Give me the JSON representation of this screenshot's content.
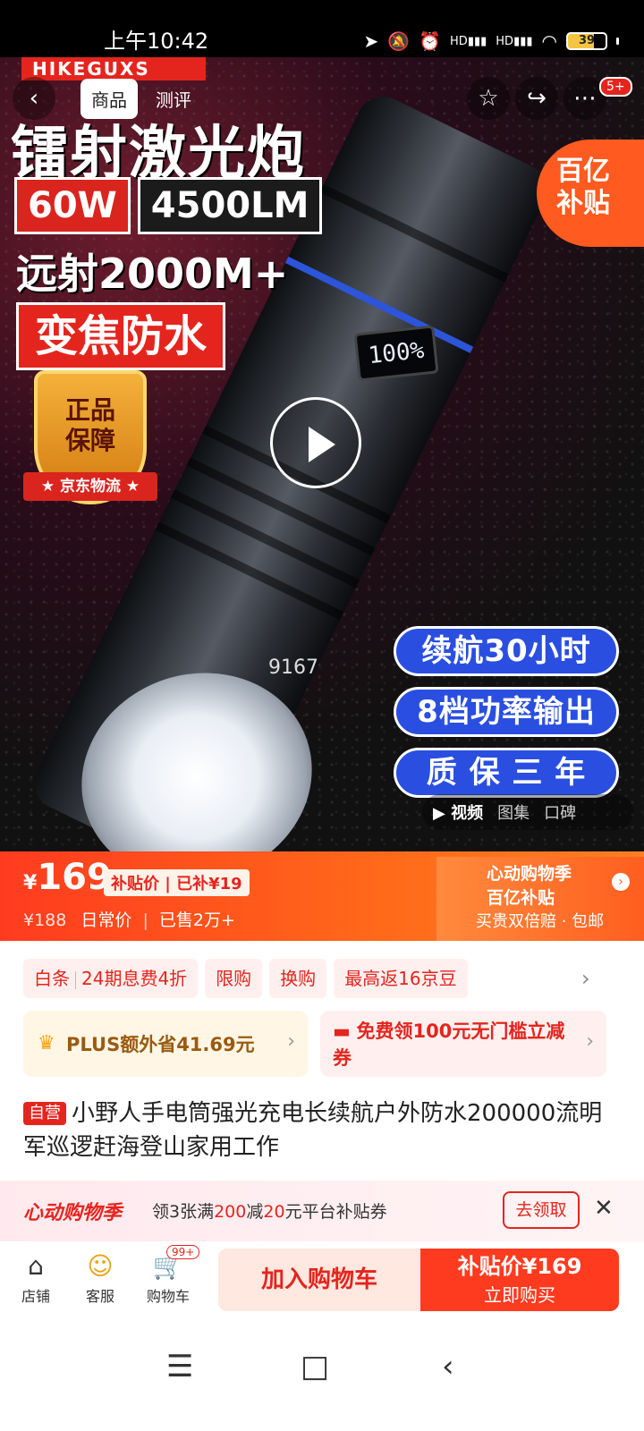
{
  "status_bar": {
    "time": "上午10:42",
    "signal1": "HD",
    "signal2": "HD",
    "battery": "39"
  },
  "header": {
    "back": "‹",
    "tabs": [
      "商品",
      "测评"
    ],
    "active_tab": "商品",
    "icons": [
      "star-icon",
      "share-icon",
      "more-icon"
    ],
    "notification_count": "5+"
  },
  "hero": {
    "brand": "HIKEGUXS",
    "headline": "镭射激光炮",
    "spec1": "60W",
    "spec2": "4500LM",
    "range": "远射2000M+",
    "feature": "变焦防水",
    "guarantee_text": "正品\n保障",
    "guarantee_ribbon": "★ 京东物流 ★",
    "display_value": "100",
    "pills": [
      "续航30小时",
      "8档功率输出",
      "质 保 三 年"
    ],
    "subsidy_badge": "百亿\n补贴",
    "image_counter": "9167",
    "media_tabs": [
      "▶ 视频",
      "图集",
      "口碑"
    ]
  },
  "price": {
    "currency": "¥",
    "value": "169",
    "subsidy_tag": "补贴价 | 已补¥19",
    "original": "¥188",
    "original_label": "日常价",
    "sold": "已售2万+",
    "promo_title": "心动购物季",
    "promo_title2": "百亿补贴",
    "promo_sub": "买贵双倍赔 · 包邮"
  },
  "chips": {
    "items": [
      "白条",
      "24期息费4折",
      "限购",
      "换购",
      "最高返16京豆"
    ]
  },
  "cards": {
    "plus": "PLUS额外省41.69元",
    "coupon_strong": "免费领100元无门槛立减券"
  },
  "product": {
    "self_tag": "自营",
    "title": "小野人手电筒强光充电长续航户外防水200000流明军巡逻赶海登山家用工作"
  },
  "banner": {
    "logo": "心动购物季",
    "text_pre": "领3张满",
    "text_red1": "200",
    "text_mid": "减",
    "text_red2": "20",
    "text_post": "元平台补贴券",
    "button": "去领取"
  },
  "bottom_bar": {
    "shop": "店铺",
    "service": "客服",
    "cart": "购物车",
    "cart_badge": "99+",
    "add_cart": "加入购物车",
    "buy_price": "补贴价¥169",
    "buy_label": "立即购买"
  },
  "colors": {
    "accent": "#e4251e",
    "orange": "#ff5e1f",
    "blue_pill": "#2a4fe0"
  }
}
